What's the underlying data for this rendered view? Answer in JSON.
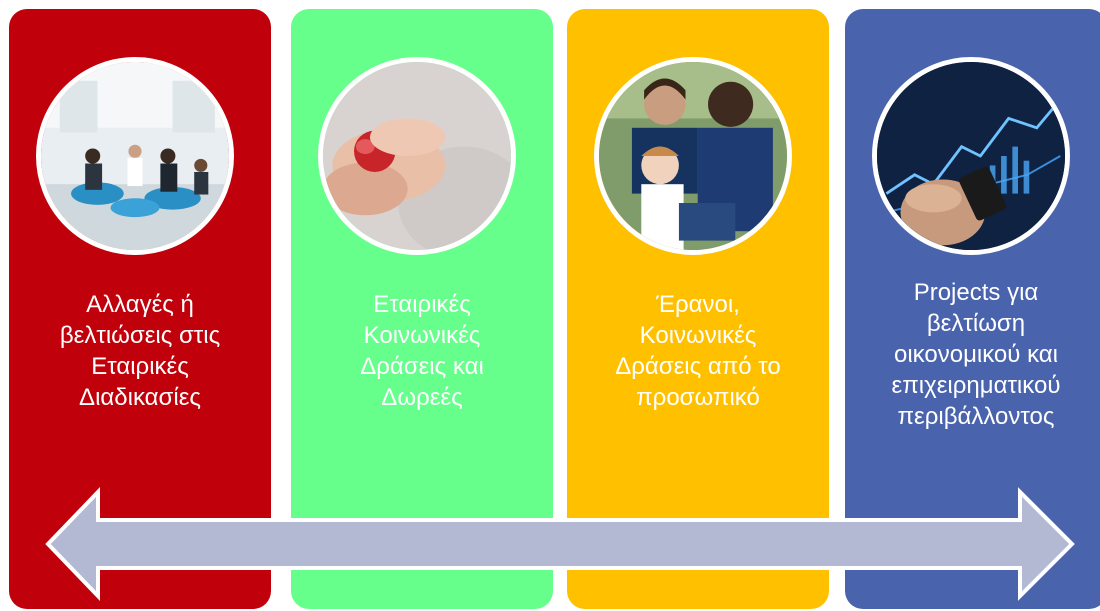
{
  "cards": [
    {
      "text": "Αλλαγές ή βελτιώσεις στις Εταιρικές Διαδικασίες",
      "lines": [
        "Αλλαγές ή",
        "βελτιώσεις στις",
        "Εταιρικές",
        "Διαδικασίες"
      ],
      "bg_color": "#c0000a",
      "text_color": "#ffffff",
      "photo_icon": "business-meeting-photo"
    },
    {
      "text": "Εταιρικές Κοινωνικές Δράσεις και Δωρεές",
      "lines": [
        "Εταιρικές",
        "Κοινωνικές",
        "Δράσεις και",
        "Δωρεές"
      ],
      "bg_color": "#66ff8c",
      "text_color": "#ffffff",
      "photo_icon": "hands-holding-heart-photo"
    },
    {
      "text": "Έρανοι, Κοινωνικές Δράσεις από το προσωπικό",
      "lines": [
        "Έρανοι,",
        "Κοινωνικές",
        "Δράσεις από το",
        "προσωπικό"
      ],
      "bg_color": "#ffc000",
      "text_color": "#ffffff",
      "photo_icon": "volunteers-group-photo"
    },
    {
      "text": "Projects για βελτίωση οικονομικού και επιχειρηματικού περιβάλλοντος",
      "lines": [
        "Projects για",
        "βελτίωση",
        "οικονομικού και",
        "επιχειρηματικού",
        "περιβάλλοντος"
      ],
      "bg_color": "#4a63ad",
      "text_color": "#ffffff",
      "photo_icon": "financial-charts-photo"
    }
  ],
  "arrow": {
    "icon": "double-headed-arrow",
    "fill_color": "#b3b9d3",
    "stroke_color": "#ffffff"
  }
}
